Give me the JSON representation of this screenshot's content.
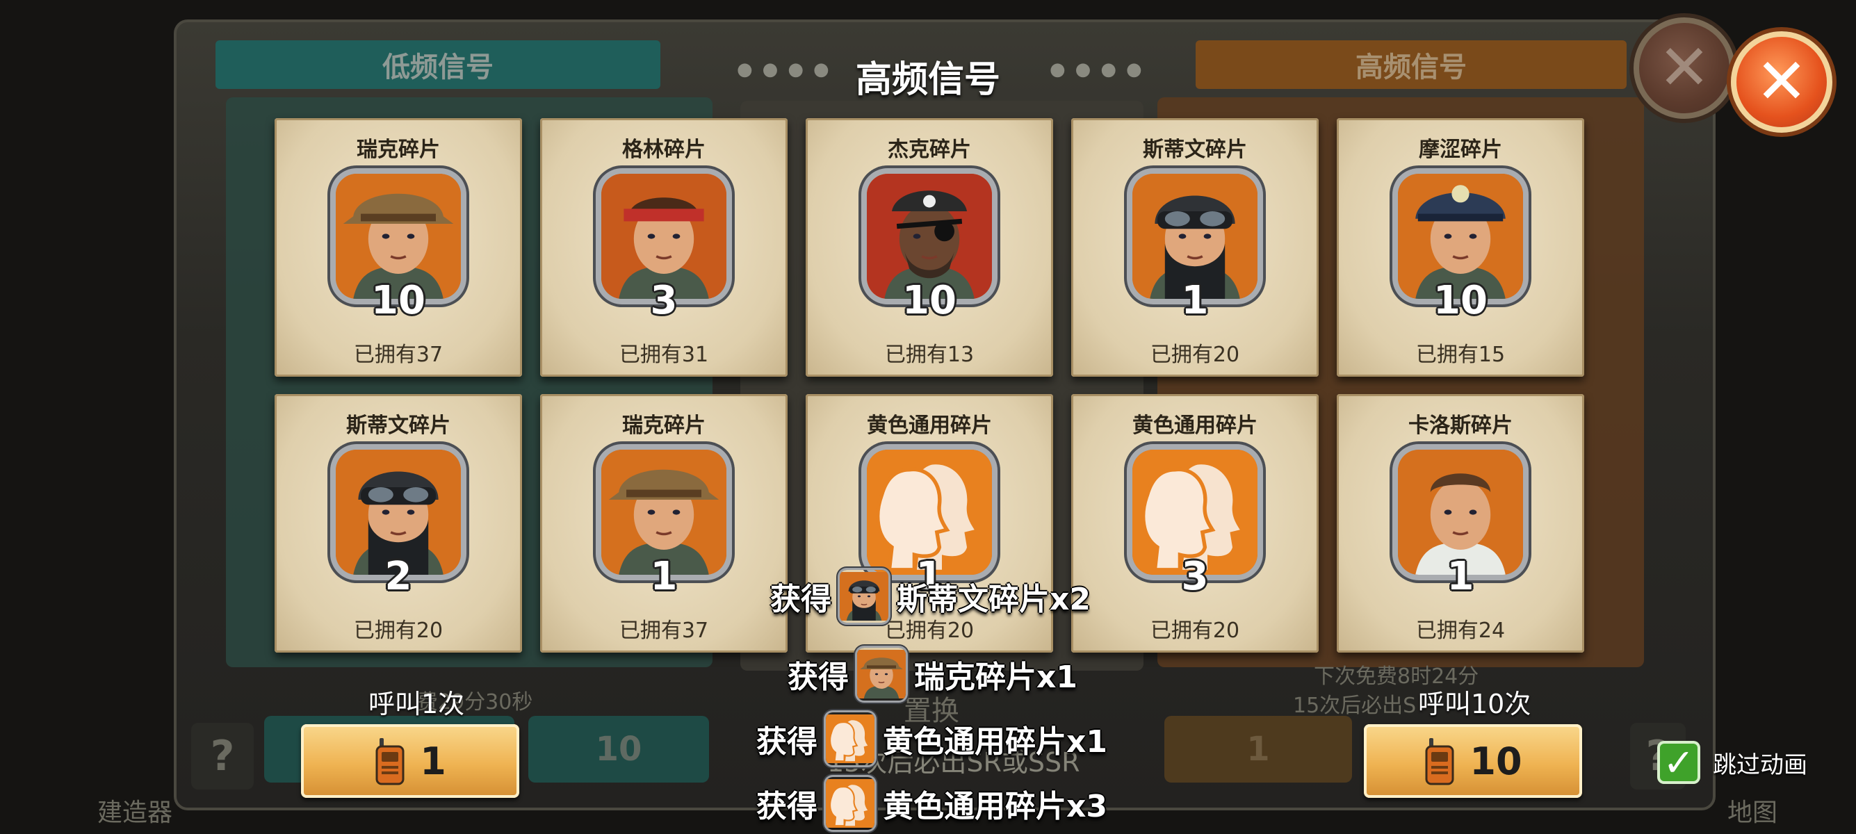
{
  "title": "高频信号",
  "background": {
    "left_banner": "低频信号",
    "right_banner": "高频信号",
    "left_timer": "费29分30秒",
    "right_timer": "下次免费8时24分",
    "right_guarantee": "15次后必出S",
    "middle_button": "置换",
    "middle_guarantee": "15次后必出SR或SSR",
    "left_btn_counts": [
      "1",
      "10"
    ],
    "right_btn_counts": [
      "1",
      "10"
    ],
    "left_corner_label": "建造器",
    "right_corner_label": "地图"
  },
  "cards": [
    {
      "name": "瑞克碎片",
      "qty": "10",
      "owned": "已拥有37",
      "portrait": "rick"
    },
    {
      "name": "格林碎片",
      "qty": "3",
      "owned": "已拥有31",
      "portrait": "green"
    },
    {
      "name": "杰克碎片",
      "qty": "10",
      "owned": "已拥有13",
      "portrait": "jack"
    },
    {
      "name": "斯蒂文碎片",
      "qty": "1",
      "owned": "已拥有20",
      "portrait": "steven"
    },
    {
      "name": "摩涩碎片",
      "qty": "10",
      "owned": "已拥有15",
      "portrait": "mose"
    },
    {
      "name": "斯蒂文碎片",
      "qty": "2",
      "owned": "已拥有20",
      "portrait": "steven"
    },
    {
      "name": "瑞克碎片",
      "qty": "1",
      "owned": "已拥有37",
      "portrait": "rick"
    },
    {
      "name": "黄色通用碎片",
      "qty": "1",
      "owned": "已拥有20",
      "portrait": "generic"
    },
    {
      "name": "黄色通用碎片",
      "qty": "3",
      "owned": "已拥有20",
      "portrait": "generic"
    },
    {
      "name": "卡洛斯碎片",
      "qty": "1",
      "owned": "已拥有24",
      "portrait": "carlos"
    }
  ],
  "calls": {
    "single_label": "呼叫1次",
    "single_count": "1",
    "ten_label": "呼叫10次",
    "ten_count": "10"
  },
  "rewards": [
    {
      "prefix": "获得",
      "item": "斯蒂文碎片x2",
      "portrait": "steven"
    },
    {
      "prefix": "获得",
      "item": "瑞克碎片x1",
      "portrait": "rick"
    },
    {
      "prefix": "获得",
      "item": "黄色通用碎片x1",
      "portrait": "generic"
    },
    {
      "prefix": "获得",
      "item": "黄色通用碎片x3",
      "portrait": "generic"
    }
  ],
  "skip_animation": {
    "label": "跳过动画",
    "checked": true
  },
  "icons": {
    "close": "close-icon",
    "walkie_talkie": "walkie-talkie-icon",
    "check": "checkmark-icon"
  },
  "colors": {
    "accent_orange": "#e5521d",
    "card_bg": "#e6d8b8",
    "button_gold": "#efb352",
    "check_green": "#3fa22a"
  }
}
